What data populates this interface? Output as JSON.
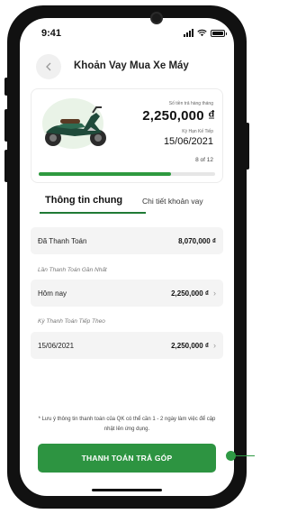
{
  "status_bar": {
    "time": "9:41"
  },
  "header": {
    "title": "Khoản Vay Mua Xe Máy",
    "back_icon": "chevron-left-icon"
  },
  "loan_card": {
    "monthly_label": "Số tiền trả hàng tháng",
    "monthly_amount": "2,250,000 ₫",
    "next_due_label": "Kỳ Hạn Kế Tiếp",
    "next_due_date": "15/06/2021",
    "term_progress_text": "8 of 12",
    "progress_fraction": 0.75
  },
  "tabs": [
    {
      "label": "Thông tin chung",
      "active": true
    },
    {
      "label": "Chi tiết khoản vay",
      "active": false
    }
  ],
  "details": {
    "paid_label": "Đã Thanh Toán",
    "paid_value": "8,070,000 ₫",
    "last_payment_section": "Lần Thanh Toán Gần Nhất",
    "last_payment_date": "Hôm nay",
    "last_payment_value": "2,250,000 ₫",
    "next_payment_section": "Kỳ Thanh Toán Tiếp Theo",
    "next_payment_date": "15/06/2021",
    "next_payment_value": "2,250,000 ₫"
  },
  "note": "* Lưu ý thông tin thanh toán của QK có thể cần 1 - 2 ngày làm việc để cập nhật lên ứng dụng.",
  "pay_button": {
    "label": "THANH TOÁN TRẢ GÓP"
  },
  "colors": {
    "accent": "#2d9441",
    "progress": "#2e9a3f"
  }
}
